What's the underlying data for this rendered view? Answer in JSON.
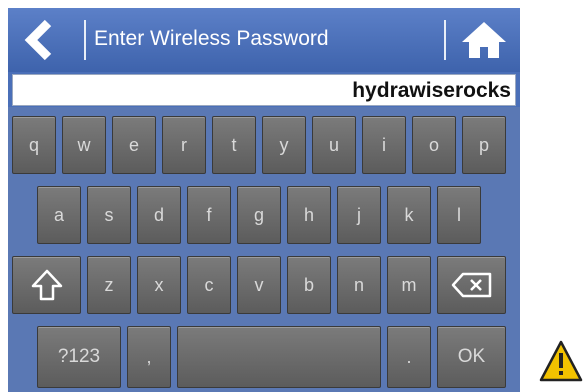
{
  "header": {
    "title": "Enter Wireless Password"
  },
  "password_field": {
    "value": "hydrawiserocks"
  },
  "keyboard": {
    "row1": [
      "q",
      "w",
      "e",
      "r",
      "t",
      "y",
      "u",
      "i",
      "o",
      "p"
    ],
    "row2": [
      "a",
      "s",
      "d",
      "f",
      "g",
      "h",
      "j",
      "k",
      "l"
    ],
    "row3": [
      "z",
      "x",
      "c",
      "v",
      "b",
      "n",
      "m"
    ],
    "row4": {
      "numbers_label": "?123",
      "comma_label": ",",
      "period_label": ".",
      "ok_label": "OK"
    }
  },
  "icons": {
    "back": "chevron-left-icon",
    "home": "home-icon",
    "shift": "shift-arrow-icon",
    "backspace": "backspace-icon",
    "warning": "warning-triangle-icon"
  },
  "colors": {
    "header": "#4a6fb8",
    "key": "#6a6a6a",
    "key_text": "#d9d9d9",
    "warning": "#f2c200"
  }
}
